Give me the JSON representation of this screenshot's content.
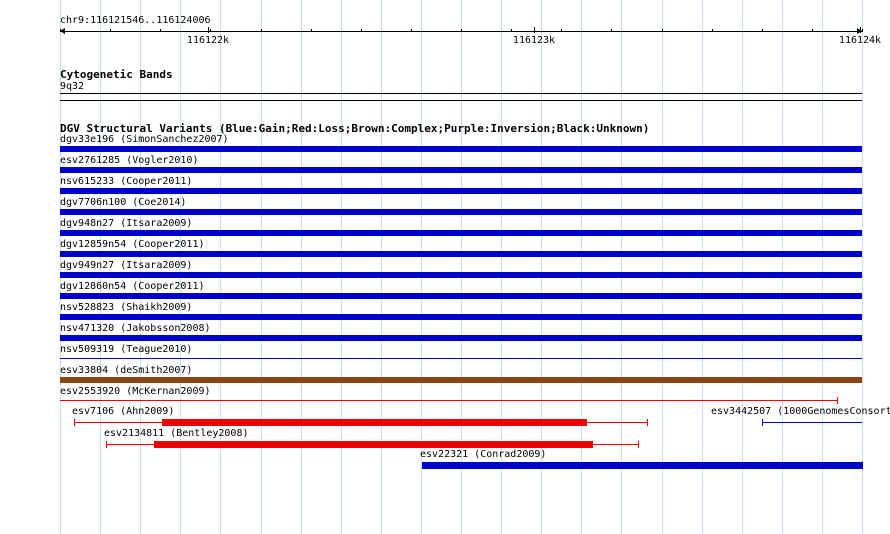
{
  "ruler": {
    "range_label": "chr9:116121546..116124006",
    "start": 116121546,
    "end": 116124006,
    "ticks": [
      {
        "pos": 116122000,
        "label": "116122k"
      },
      {
        "pos": 116123000,
        "label": "116123k"
      },
      {
        "pos": 116124000,
        "label": "116124k"
      }
    ]
  },
  "cytoband": {
    "title": "Cytogenetic Bands",
    "band_label": "9q32"
  },
  "dgv": {
    "title": "DGV Structural Variants (Blue:Gain;Red:Loss;Brown:Complex;Purple:Inversion;Black:Unknown)",
    "colors": {
      "gain": "#0000cc",
      "loss": "#ee0000",
      "complex": "#8b4513",
      "inversion": "#800080",
      "unknown": "#000000"
    },
    "features": [
      {
        "id": "dgv33e196",
        "study": "SimonSanchez2007",
        "label": "dgv33e196 (SimonSanchez2007)",
        "type": "gain",
        "style": "thick",
        "start": 116121546,
        "end": 116124006
      },
      {
        "id": "esv2761285",
        "study": "Vogler2010",
        "label": "esv2761285 (Vogler2010)",
        "type": "gain",
        "style": "thick",
        "start": 116121546,
        "end": 116124006
      },
      {
        "id": "nsv615233",
        "study": "Cooper2011",
        "label": "nsv615233 (Cooper2011)",
        "type": "gain",
        "style": "thick",
        "start": 116121546,
        "end": 116124006
      },
      {
        "id": "dgv7706n100",
        "study": "Coe2014",
        "label": "dgv7706n100 (Coe2014)",
        "type": "gain",
        "style": "thick",
        "start": 116121546,
        "end": 116124006
      },
      {
        "id": "dgv948n27",
        "study": "Itsara2009",
        "label": "dgv948n27 (Itsara2009)",
        "type": "gain",
        "style": "thick",
        "start": 116121546,
        "end": 116124006
      },
      {
        "id": "dgv12859n54",
        "study": "Cooper2011",
        "label": "dgv12859n54 (Cooper2011)",
        "type": "gain",
        "style": "thick",
        "start": 116121546,
        "end": 116124006
      },
      {
        "id": "dgv949n27",
        "study": "Itsara2009",
        "label": "dgv949n27 (Itsara2009)",
        "type": "gain",
        "style": "thick",
        "start": 116121546,
        "end": 116124006
      },
      {
        "id": "dgv12860n54",
        "study": "Cooper2011",
        "label": "dgv12860n54 (Cooper2011)",
        "type": "gain",
        "style": "thick",
        "start": 116121546,
        "end": 116124006
      },
      {
        "id": "nsv528823",
        "study": "Shaikh2009",
        "label": "nsv528823 (Shaikh2009)",
        "type": "gain",
        "style": "thick",
        "start": 116121546,
        "end": 116124006
      },
      {
        "id": "nsv471320",
        "study": "Jakobsson2008",
        "label": "nsv471320 (Jakobsson2008)",
        "type": "gain",
        "style": "thick",
        "start": 116121546,
        "end": 116124006
      },
      {
        "id": "nsv509319",
        "study": "Teague2010",
        "label": "nsv509319 (Teague2010)",
        "type": "gain",
        "style": "thin",
        "start": 116121546,
        "end": 116124006
      },
      {
        "id": "esv33804",
        "study": "deSmith2007",
        "label": "esv33804 (deSmith2007)",
        "type": "complex",
        "style": "thick",
        "start": 116121546,
        "end": 116124006
      },
      {
        "id": "esv2553920",
        "study": "McKernan2009",
        "label": "esv2553920 (McKernan2009)",
        "type": "loss",
        "style": "thin",
        "start": 116121546,
        "end": 116123930,
        "end_cap": true
      }
    ],
    "packed": [
      {
        "id": "esv7106",
        "study": "Ahn2009",
        "label": "esv7106 (Ahn2009)",
        "type": "loss",
        "start": 116121590,
        "end": 116123345,
        "thick_start": 116121860,
        "thick_end": 116123163
      },
      {
        "id": "esv3442507",
        "study": "1000GenomesConsort",
        "label": "esv3442507 (1000GenomesConsort",
        "type": "gain",
        "start": 116123700,
        "end": 116124006,
        "thin": true
      },
      {
        "id": "esv2134811",
        "study": "Bentley2008",
        "label": "esv2134811 (Bentley2008)",
        "type": "loss",
        "start": 116121688,
        "end": 116123318,
        "thick_start": 116121835,
        "thick_end": 116123182
      },
      {
        "id": "esv22321",
        "study": "Conrad2009",
        "label": "esv22321 (Conrad2009)",
        "type": "gain",
        "start": 116122656,
        "end": 116124006,
        "thick_start": 116122656,
        "thick_end": 116124006
      }
    ]
  }
}
